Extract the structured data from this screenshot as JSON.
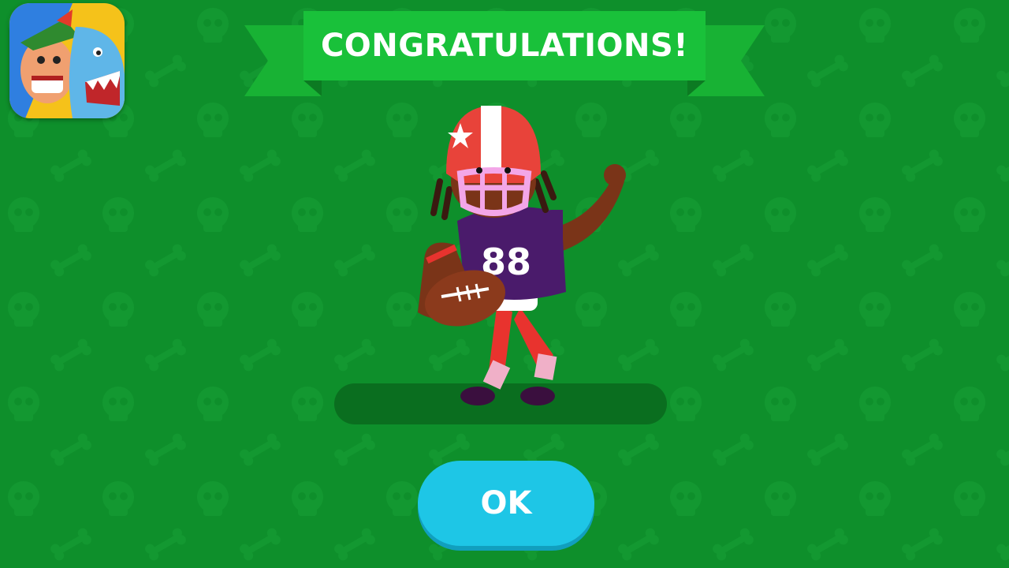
{
  "header": {
    "banner_title": "CONGRATULATIONS!",
    "banner_color": "#19c13a"
  },
  "app_icon": {
    "icon": "bowmasters-app-icon"
  },
  "character": {
    "jersey_number": "88",
    "icon": "football-player-character"
  },
  "actions": {
    "ok_label": "OK"
  },
  "colors": {
    "background": "#0e8f2b",
    "pattern": "#128e2e",
    "button": "#1ec6e6",
    "jersey": "#4a1b6b",
    "helmet": "#e8433a"
  }
}
